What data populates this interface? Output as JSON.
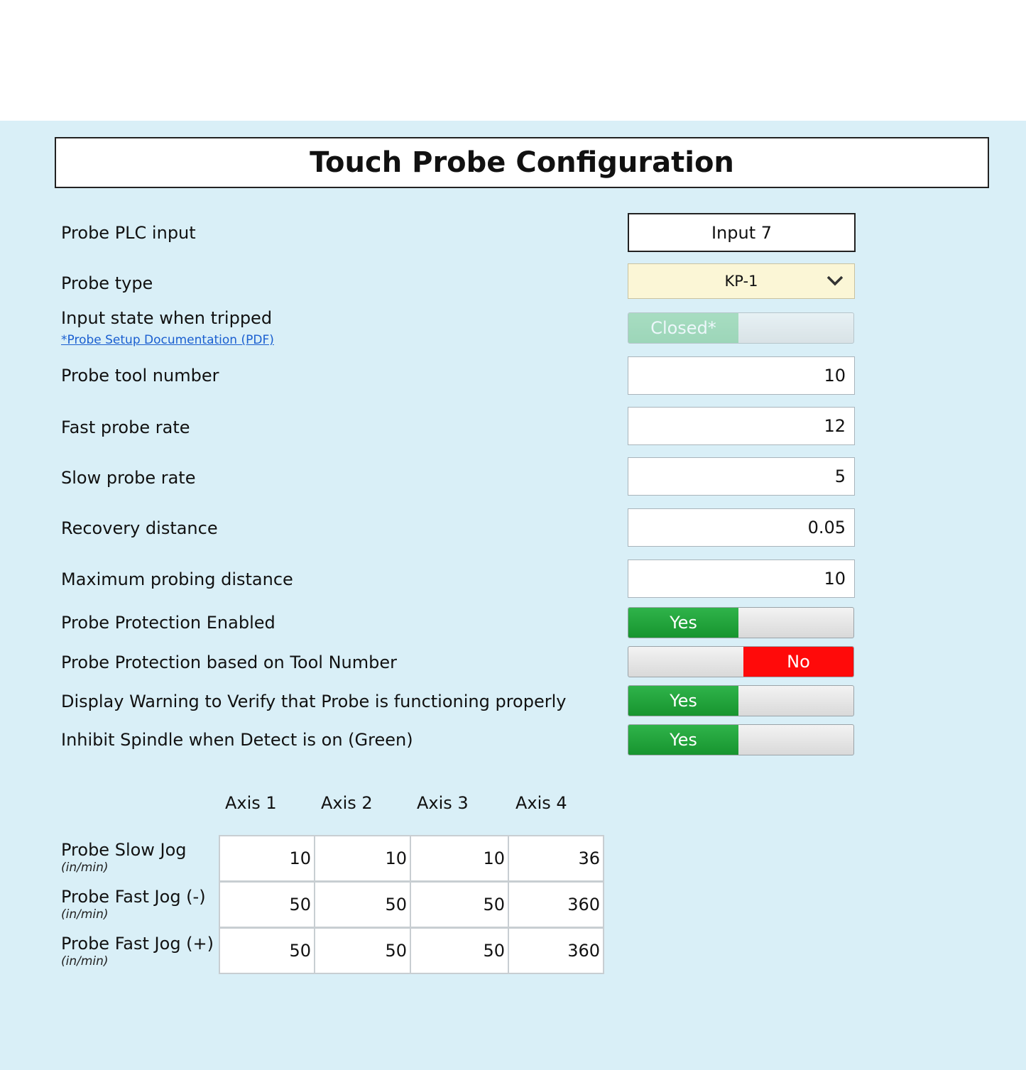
{
  "title": "Touch Probe Configuration",
  "settings": {
    "plc_input": {
      "label": "Probe PLC input",
      "value": "Input 7"
    },
    "probe_type": {
      "label": "Probe type",
      "value": "KP-1"
    },
    "input_state": {
      "label": "Input state when tripped",
      "link": "*Probe Setup Documentation (PDF)",
      "value": "Closed*"
    },
    "tool_number": {
      "label": "Probe tool number",
      "value": "10"
    },
    "fast_rate": {
      "label": "Fast probe rate",
      "value": "12"
    },
    "slow_rate": {
      "label": "Slow probe rate",
      "value": "5"
    },
    "recovery": {
      "label": "Recovery distance",
      "value": "0.05"
    },
    "max_distance": {
      "label": "Maximum probing distance",
      "value": "10"
    },
    "protection": {
      "label": "Probe Protection Enabled",
      "value": "Yes"
    },
    "protection_tool": {
      "label": "Probe Protection based on Tool Number",
      "value": "No"
    },
    "warning": {
      "label": "Display Warning to Verify that Probe is functioning properly",
      "value": "Yes"
    },
    "inhibit": {
      "label": "Inhibit Spindle when Detect is on (Green)",
      "value": "Yes"
    }
  },
  "colors": {
    "yes": "#1fa33a",
    "no": "#ff0a0a",
    "panel": "#d9eff7",
    "dropdown": "#fbf6d6"
  },
  "jog_table": {
    "headers": [
      "Axis 1",
      "Axis 2",
      "Axis 3",
      "Axis 4"
    ],
    "unit": "(in/min)",
    "rows": [
      {
        "label": "Probe Slow Jog",
        "values": [
          "10",
          "10",
          "10",
          "36"
        ]
      },
      {
        "label": "Probe Fast Jog (-)",
        "values": [
          "50",
          "50",
          "50",
          "360"
        ]
      },
      {
        "label": "Probe Fast Jog (+)",
        "values": [
          "50",
          "50",
          "50",
          "360"
        ]
      }
    ]
  }
}
